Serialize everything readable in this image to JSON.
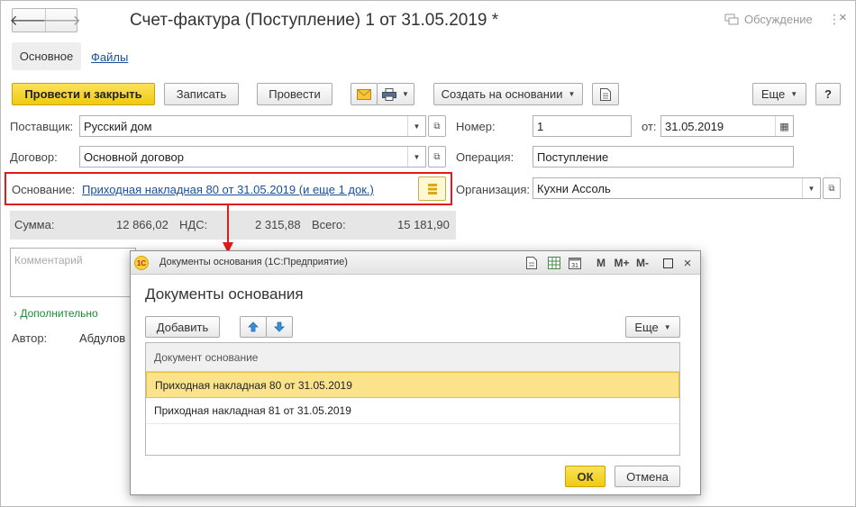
{
  "window": {
    "title": "Счет-фактура (Поступление) 1 от 31.05.2019 *",
    "discussion_label": "Обсуждение"
  },
  "tabs": [
    {
      "label": "Основное"
    },
    {
      "label": "Файлы"
    }
  ],
  "toolbar": {
    "post_close": "Провести и закрыть",
    "save": "Записать",
    "post": "Провести",
    "create_based_on": "Создать на основании",
    "more": "Еще",
    "help": "?"
  },
  "form": {
    "supplier_label": "Поставщик:",
    "supplier_value": "Русский дом",
    "contract_label": "Договор:",
    "contract_value": "Основной договор",
    "basis_label": "Основание:",
    "basis_link": "Приходная накладная 80 от 31.05.2019  (и еще 1 док.)",
    "number_label": "Номер:",
    "number_value": "1",
    "date_label": "от:",
    "date_value": "31.05.2019",
    "operation_label": "Операция:",
    "operation_value": "Поступление",
    "org_label": "Организация:",
    "org_value": "Кухни Ассоль",
    "sum_label": "Сумма:",
    "sum_value": "12 866,02",
    "vat_label": "НДС:",
    "vat_value": "2 315,88",
    "total_label": "Всего:",
    "total_value": "15 181,90",
    "comment_placeholder": "Комментарий",
    "more_section": "Дополнительно",
    "author_label": "Автор:",
    "author_value": "Абдулов"
  },
  "dialog": {
    "window_title": "Документы основания  (1С:Предприятие)",
    "heading": "Документы основания",
    "add_button": "Добавить",
    "more_button": "Еще",
    "column_header": "Документ основание",
    "rows": [
      "Приходная накладная 80 от 31.05.2019",
      "Приходная накладная 81 от 31.05.2019"
    ],
    "ok": "ОК",
    "cancel": "Отмена",
    "titlebar_icons": [
      "M",
      "M+",
      "M-"
    ]
  },
  "colors": {
    "primary_button": "#f0cb10",
    "highlight_border": "#e11b1b",
    "selected_row": "#fbe38c",
    "link": "#1a4f9a"
  }
}
